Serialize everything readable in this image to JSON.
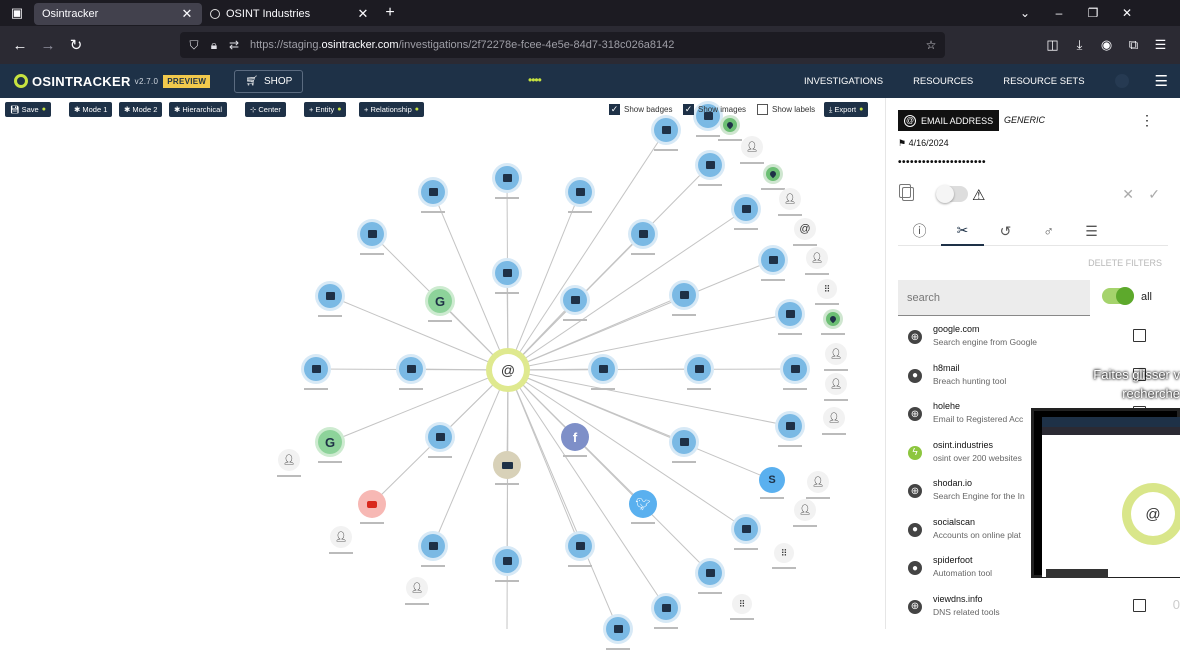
{
  "browser": {
    "tabs": [
      {
        "label": "Osintracker",
        "active": true
      },
      {
        "label": "OSINT Industries",
        "active": false
      }
    ],
    "url_prefix": "https://staging.",
    "url_domain": "osintracker.com",
    "url_path": "/investigations/2f72278e-fcee-4e5e-84d7-318c026a8142"
  },
  "app": {
    "logo": "OSINTRACKER",
    "version": "v2.7.0",
    "preview": "PREVIEW",
    "shop": "SHOP",
    "dots": "••••",
    "nav": [
      "INVESTIGATIONS",
      "RESOURCES",
      "RESOURCE SETS"
    ]
  },
  "toolbar": {
    "save": "Save",
    "mode1": "Mode 1",
    "mode2": "Mode 2",
    "hierarchical": "Hierarchical",
    "center": "Center",
    "entity": "+ Entity",
    "relationship": "+ Relationship",
    "show_badges": "Show badges",
    "show_images": "Show images",
    "show_labels": "Show labels",
    "export": "Export"
  },
  "panel": {
    "type": "EMAIL ADDRESS",
    "subtype": "GENERIC",
    "date": "4/16/2024",
    "masked_value": "••••••••••••••••••••••",
    "delete_filters": "DELETE FILTERS",
    "search_placeholder": "search",
    "all_label": "all",
    "tools": [
      {
        "name": "google.com",
        "desc": "Search engine from Google",
        "icon": "globe-icon"
      },
      {
        "name": "h8mail",
        "desc": "Breach hunting tool",
        "icon": "github-icon"
      },
      {
        "name": "holehe",
        "desc": "Email to Registered Acc",
        "icon": "globe-icon"
      },
      {
        "name": "osint.industries",
        "desc": "osint over 200 websites",
        "icon": "bolt-icon"
      },
      {
        "name": "shodan.io",
        "desc": "Search Engine for the In",
        "icon": "globe-icon"
      },
      {
        "name": "socialscan",
        "desc": "Accounts on online plat",
        "icon": "github-icon"
      },
      {
        "name": "spiderfoot",
        "desc": "Automation tool",
        "icon": "github-icon"
      },
      {
        "name": "viewdns.info",
        "desc": "DNS related tools",
        "icon": "globe-icon"
      }
    ]
  },
  "overlay": {
    "line1": "Faites glisser v",
    "line2": "recherche",
    "corner": "0"
  },
  "colors": {
    "navy": "#1e3147",
    "lime": "#c7e240",
    "node_blue": "#7ab9e4",
    "toggle_green": "#5da92c"
  }
}
